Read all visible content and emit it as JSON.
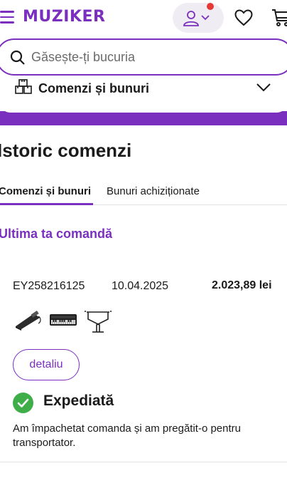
{
  "header": {
    "logo": "MUZIKER"
  },
  "search": {
    "placeholder": "Găsește-ți bucuria"
  },
  "section_selector": {
    "label": "Comenzi și bunuri"
  },
  "page": {
    "title": "Istoric comenzi"
  },
  "tabs": [
    {
      "label": "Comenzi și bunuri",
      "active": true
    },
    {
      "label": "Bunuri achiziționate",
      "active": false
    }
  ],
  "last_order": {
    "heading": "Ultima ta comandă",
    "number": "EY258216125",
    "date": "10.04.2025",
    "total": "2.023,89 lei",
    "products": [
      "sustain-pedal",
      "keyboard",
      "keyboard-stand"
    ],
    "detail_button": "detaliu",
    "status": "Expediată",
    "status_description": "Am împachetat comanda și am pregătit-o pentru transportator."
  },
  "colors": {
    "brand": "#7b2fbf",
    "status_ok": "#3fae49",
    "notification": "#e53935"
  }
}
